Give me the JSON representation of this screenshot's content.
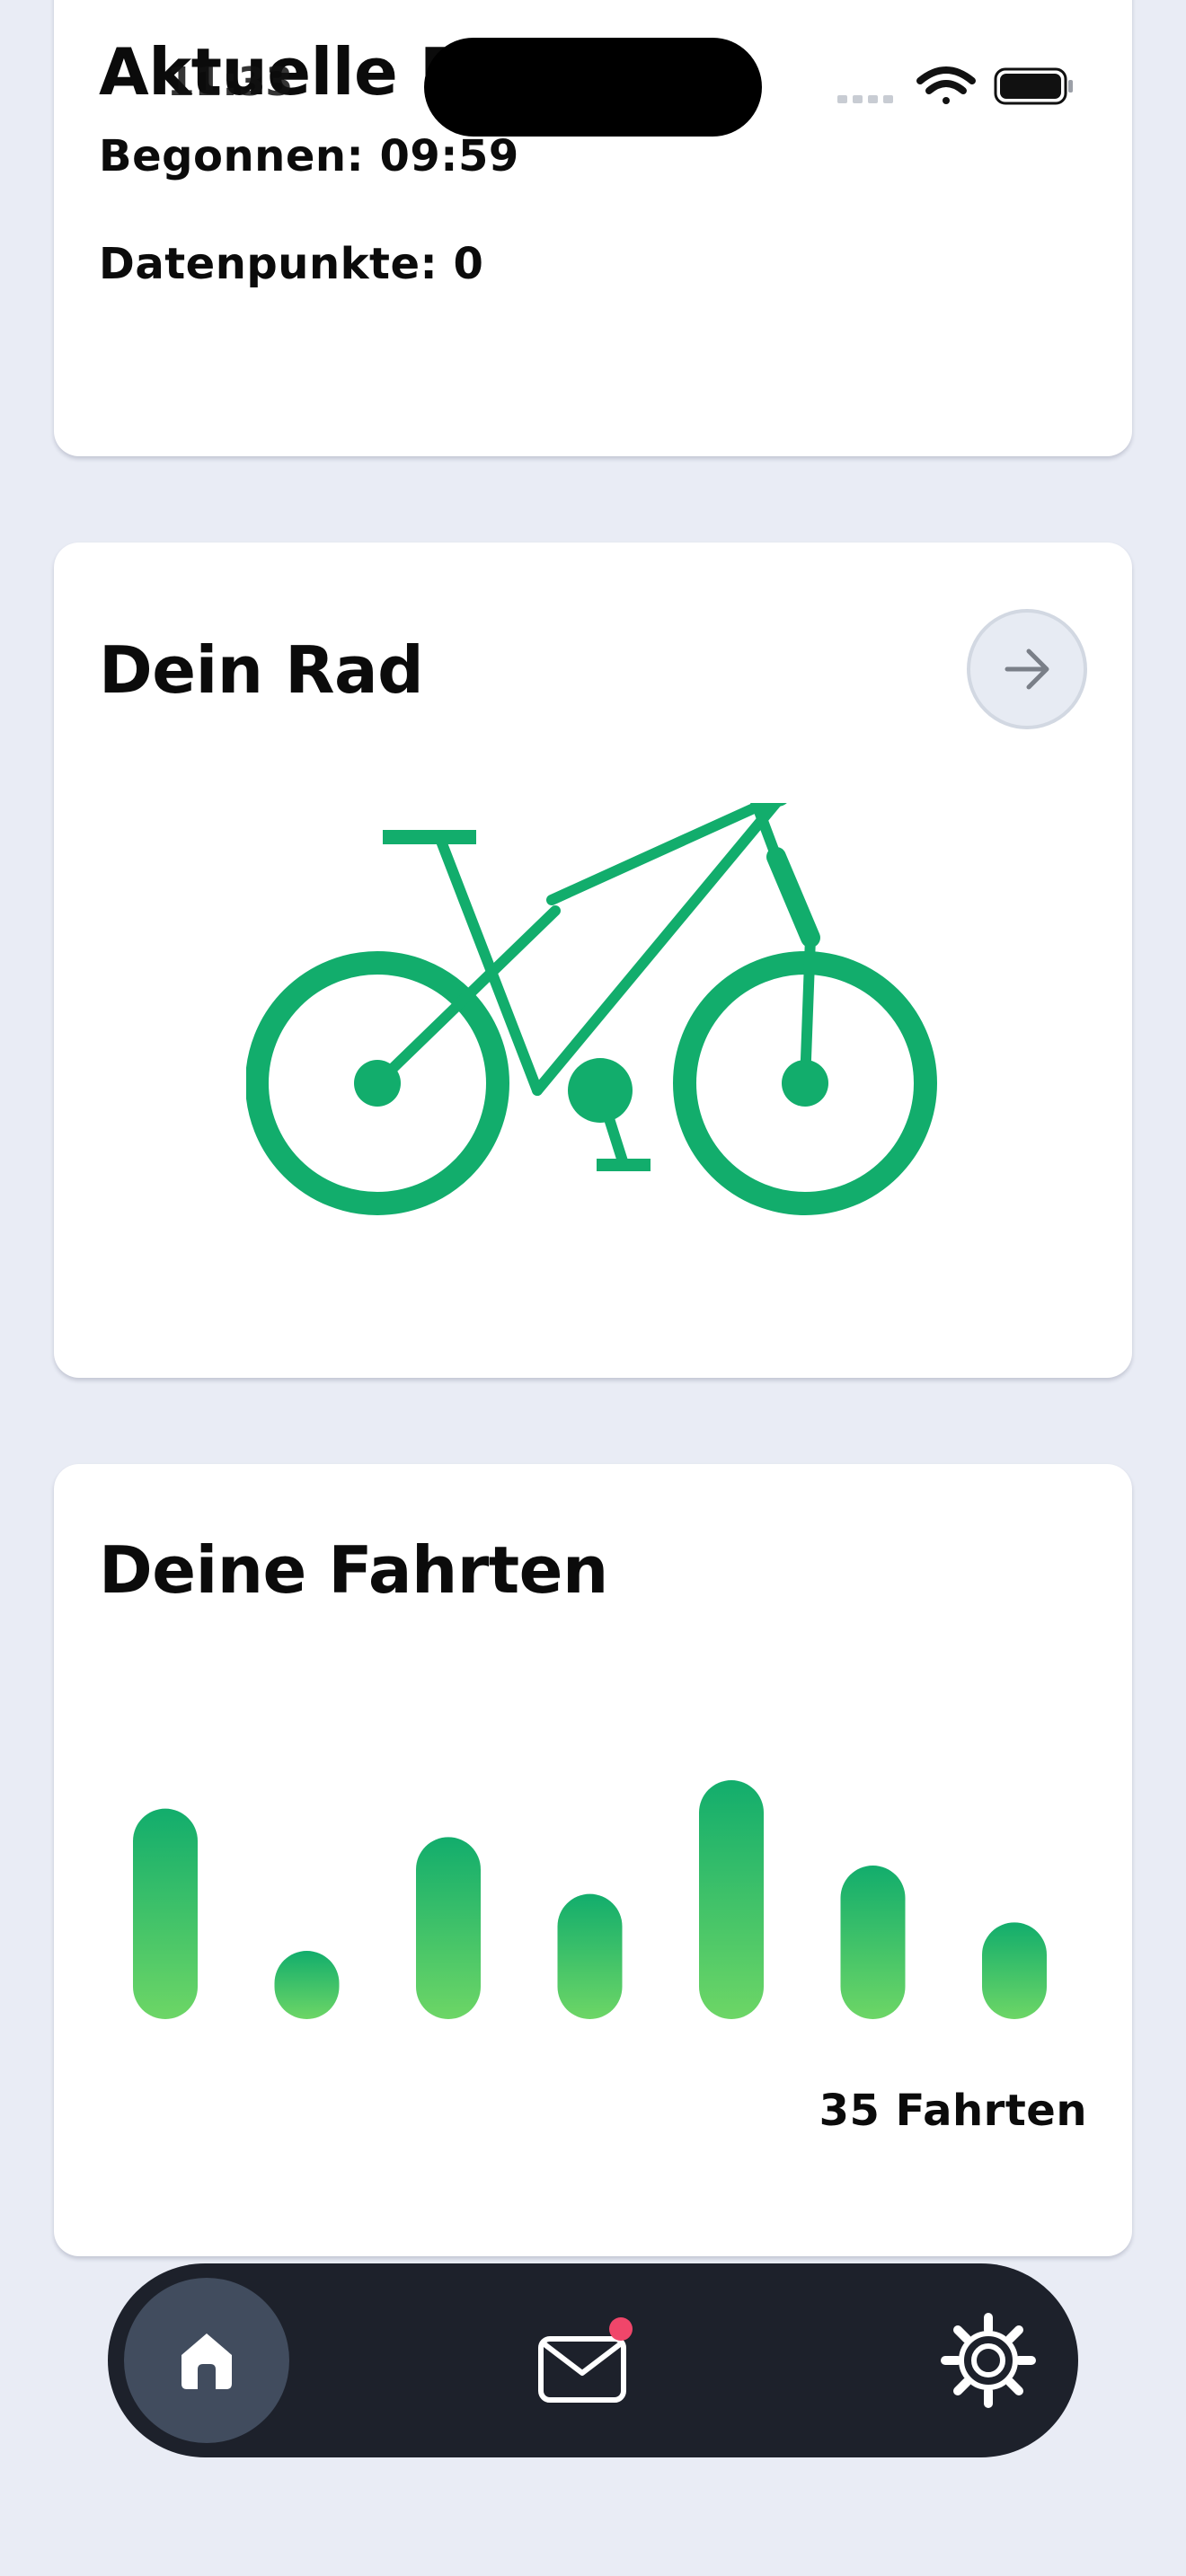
{
  "status_bar": {
    "time": "11:33"
  },
  "current_ride": {
    "title": "Aktuelle Fahrt",
    "started": "Begonnen: 09:59",
    "data_points": "Datenpunkte: 0"
  },
  "bike": {
    "title": "Dein Rad",
    "icon": "arrow-right-icon",
    "illustration": "bicycle-icon",
    "color": "#12ad6c"
  },
  "rides": {
    "title": "Deine Fahrten",
    "count_label": "35 Fahrten",
    "gradient_top": "#12ad6c",
    "gradient_bottom": "#6dd666"
  },
  "tab_bar": {
    "items": [
      {
        "id": "home",
        "icon": "home-icon",
        "active": true
      },
      {
        "id": "messages",
        "icon": "mail-icon",
        "badge": true,
        "badge_color": "#f0466a"
      },
      {
        "id": "settings",
        "icon": "gear-icon"
      }
    ]
  },
  "chart_data": {
    "type": "bar",
    "categories": [
      "",
      "",
      "",
      "",
      "",
      "",
      ""
    ],
    "values": [
      7,
      2,
      6,
      4,
      8,
      5,
      3
    ],
    "title": "",
    "xlabel": "",
    "ylabel": "",
    "ylim": [
      0,
      8
    ]
  }
}
